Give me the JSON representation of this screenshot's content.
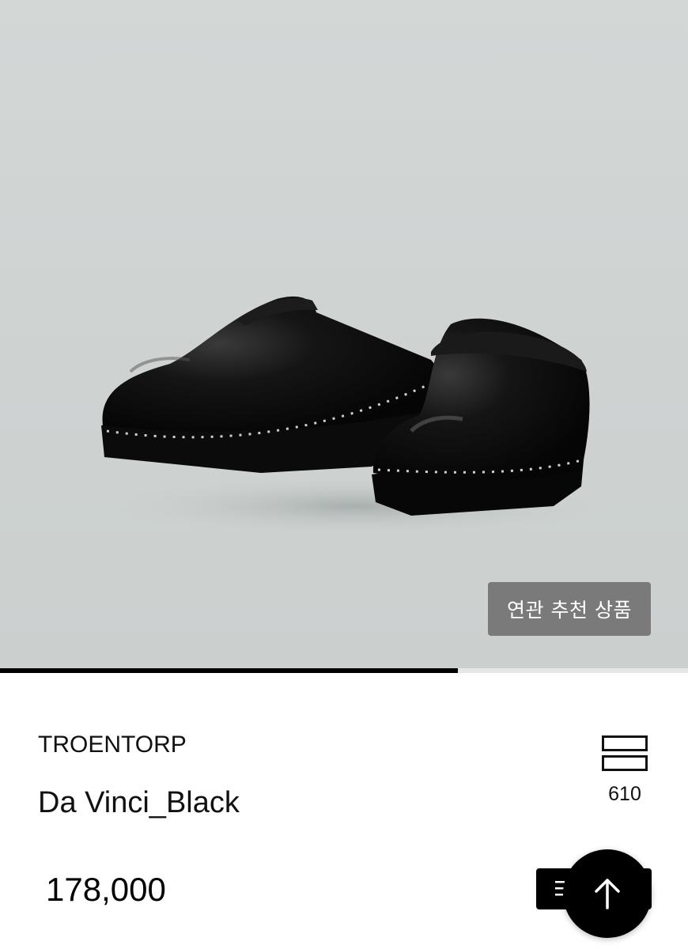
{
  "hero": {
    "image": "black-leather-clogs-photo",
    "related_button_label": "연관 추천 상품"
  },
  "carousel": {
    "progress": 0.666
  },
  "product": {
    "brand": "TROENTORP",
    "name": "Da Vinci_Black",
    "price": "178,000"
  },
  "like": {
    "icon": "bookmark-stack-icon",
    "count": "610"
  },
  "actions": {
    "list_icon": "menu-icon",
    "top_icon": "arrow-up-icon"
  },
  "colors": {
    "background": "#cfd4d3",
    "button_gray": "#7a7a7a",
    "accent": "#000000"
  }
}
